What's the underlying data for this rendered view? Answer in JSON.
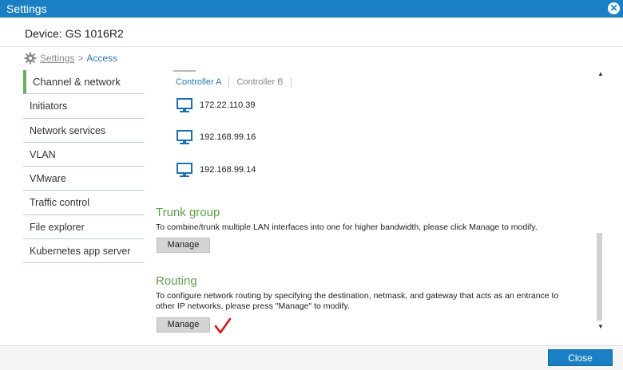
{
  "window": {
    "title": "Settings"
  },
  "device": {
    "label": "Device: GS 1016R2"
  },
  "breadcrumb": {
    "root": "Settings",
    "separator": ">",
    "current": "Access"
  },
  "sidebar": {
    "items": [
      {
        "label": "Channel & network"
      },
      {
        "label": "Initiators"
      },
      {
        "label": "Network services"
      },
      {
        "label": "VLAN"
      },
      {
        "label": "VMware"
      },
      {
        "label": "Traffic control"
      },
      {
        "label": "File explorer"
      },
      {
        "label": "Kubernetes app server"
      }
    ]
  },
  "tabs": {
    "a": "Controller A",
    "b": "Controller B"
  },
  "ips": [
    "172.22.110.39",
    "192.168.99.16",
    "192.168.99.14"
  ],
  "trunk": {
    "title": "Trunk group",
    "text": "To combine/trunk multiple LAN interfaces into one for higher bandwidth, please click Manage to modify.",
    "button": "Manage"
  },
  "routing": {
    "title": "Routing",
    "text": "To configure network routing by specifying the destination, netmask, and gateway that acts as an entrance to other IP networks, please press \"Manage\" to modify.",
    "button": "Manage"
  },
  "footer": {
    "close": "Close"
  },
  "colors": {
    "accent": "#1a7fc4",
    "section": "#5ea14a",
    "active": "#66b05a",
    "annotation": "#d11"
  }
}
